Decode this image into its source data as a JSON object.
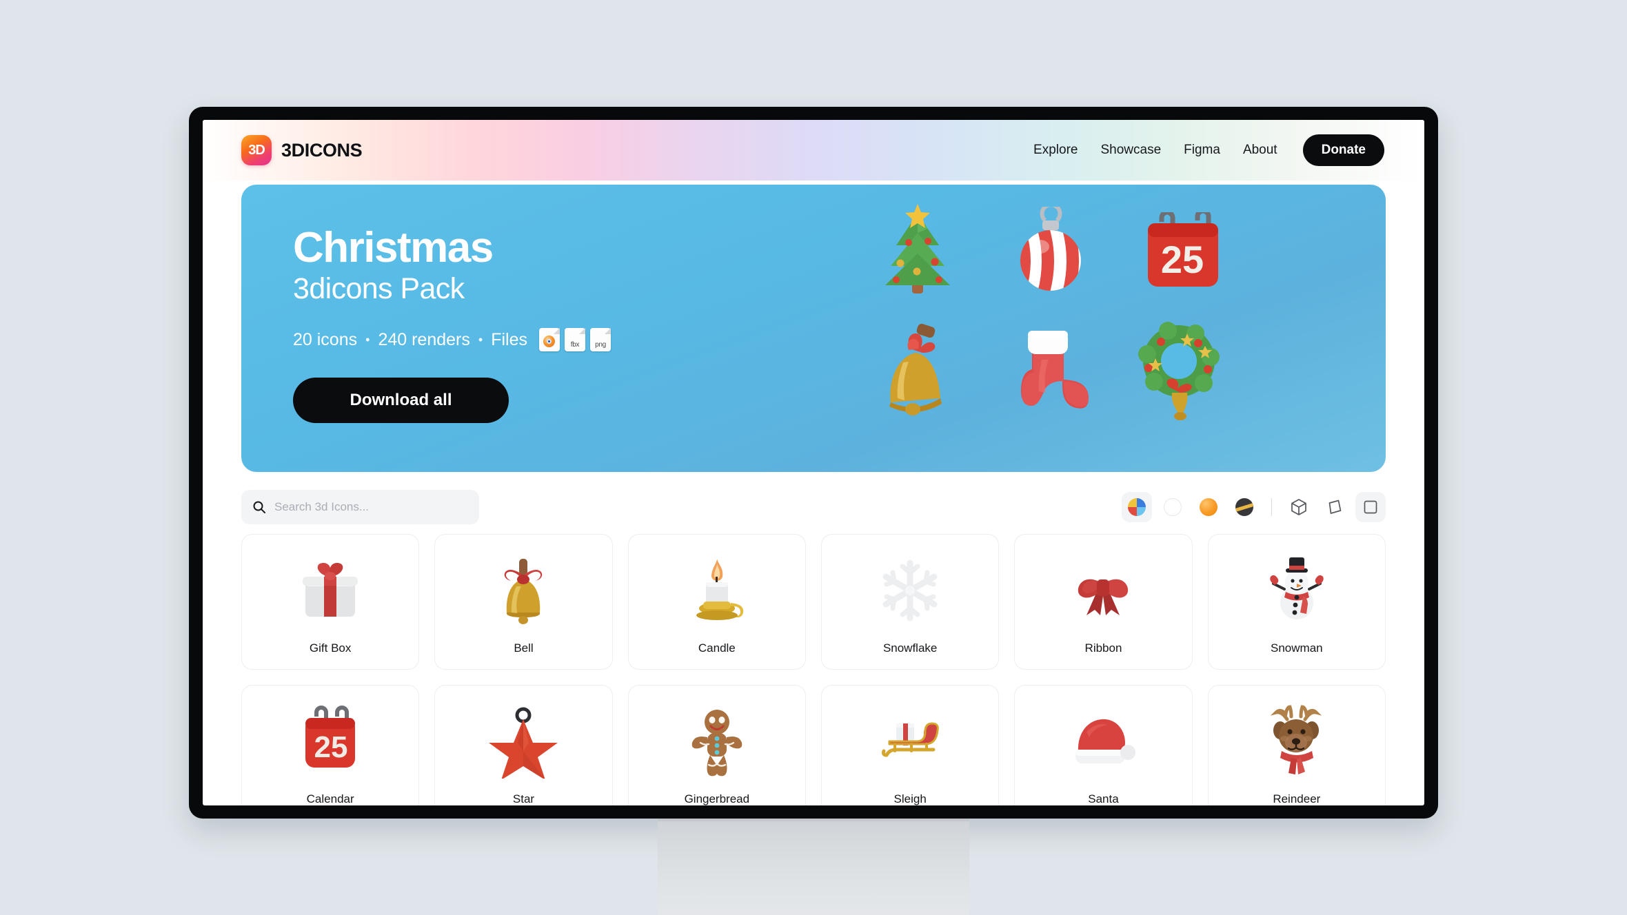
{
  "site": {
    "brand_mark": "3D",
    "brand_name": "3DICONS",
    "nav": [
      {
        "label": "Explore",
        "name": "nav-explore"
      },
      {
        "label": "Showcase",
        "name": "nav-showcase"
      },
      {
        "label": "Figma",
        "name": "nav-figma"
      },
      {
        "label": "About",
        "name": "nav-about"
      }
    ],
    "donate_label": "Donate"
  },
  "banner": {
    "title": "Christmas",
    "subtitle": "3dicons Pack",
    "icons_count": "20 icons",
    "renders_count": "240 renders",
    "files_label": "Files",
    "separator": "•",
    "file_types": [
      "blend",
      "fbx",
      "png"
    ],
    "cta_label": "Download all",
    "bg_color": "#58bbe5",
    "illustrations": [
      "christmas-tree",
      "bauble",
      "calendar-25",
      "bell",
      "stocking",
      "wreath"
    ]
  },
  "toolbar": {
    "search_placeholder": "Search 3d Icons...",
    "search_value": "",
    "color_filters": [
      {
        "name": "filter-color-multi",
        "selected": true
      },
      {
        "name": "filter-color-white",
        "selected": false
      },
      {
        "name": "filter-color-orange",
        "selected": false
      },
      {
        "name": "filter-color-dark",
        "selected": false
      }
    ],
    "style_filters": [
      {
        "name": "filter-style-isometric",
        "selected": false
      },
      {
        "name": "filter-style-dynamic",
        "selected": false
      },
      {
        "name": "filter-style-front",
        "selected": true
      }
    ]
  },
  "grid": {
    "items": [
      {
        "label": "Gift Box",
        "icon": "gift-box"
      },
      {
        "label": "Bell",
        "icon": "bell"
      },
      {
        "label": "Candle",
        "icon": "candle"
      },
      {
        "label": "Snowflake",
        "icon": "snowflake"
      },
      {
        "label": "Ribbon",
        "icon": "ribbon"
      },
      {
        "label": "Snowman",
        "icon": "snowman"
      },
      {
        "label": "Calendar",
        "icon": "calendar"
      },
      {
        "label": "Star",
        "icon": "star"
      },
      {
        "label": "Gingerbread",
        "icon": "gingerbread"
      },
      {
        "label": "Sleigh",
        "icon": "sleigh"
      },
      {
        "label": "Santa",
        "icon": "santa-hat"
      },
      {
        "label": "Reindeer",
        "icon": "reindeer"
      }
    ]
  }
}
